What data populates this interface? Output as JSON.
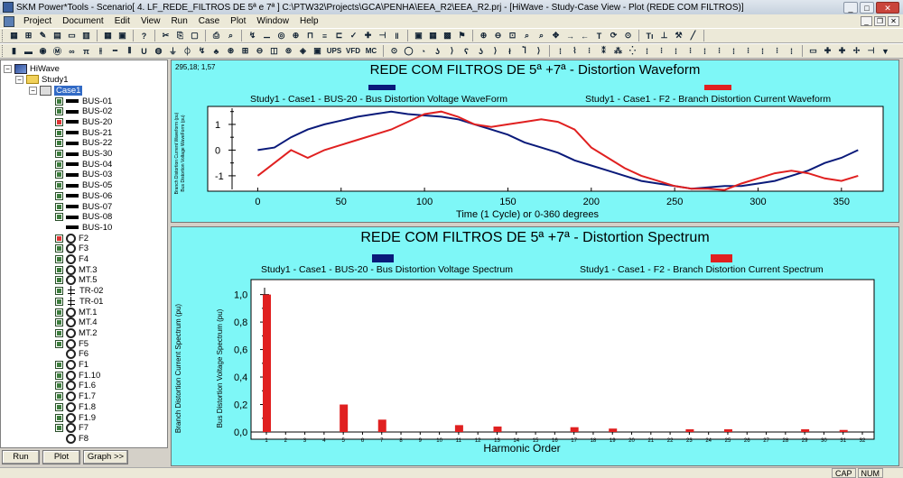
{
  "window": {
    "title": "SKM Power*Tools - Scenario[ 4. LF_REDE_FILTROS DE 5ª e 7ª ] C:\\PTW32\\Projects\\GCA\\PENHA\\EEA_R2\\EEA_R2.prj - [HiWave - Study-Case View - Plot (REDE COM FILTROS)]"
  },
  "menu": [
    "Project",
    "Document",
    "Edit",
    "View",
    "Run",
    "Case",
    "Plot",
    "Window",
    "Help"
  ],
  "toolbar1": [
    "UPS",
    "VFD",
    "MC"
  ],
  "tree": {
    "root": "HiWave",
    "study": "Study1",
    "case": "Case1",
    "items": [
      {
        "label": "BUS-01",
        "kind": "bus",
        "checked": false
      },
      {
        "label": "BUS-02",
        "kind": "bus",
        "checked": false
      },
      {
        "label": "BUS-20",
        "kind": "bus",
        "checked": true
      },
      {
        "label": "BUS-21",
        "kind": "bus",
        "checked": false
      },
      {
        "label": "BUS-22",
        "kind": "bus",
        "checked": false
      },
      {
        "label": "BUS-30",
        "kind": "bus",
        "checked": false
      },
      {
        "label": "BUS-04",
        "kind": "bus",
        "checked": false
      },
      {
        "label": "BUS-03",
        "kind": "bus",
        "checked": false
      },
      {
        "label": "BUS-05",
        "kind": "bus",
        "checked": false
      },
      {
        "label": "BUS-06",
        "kind": "bus",
        "checked": false
      },
      {
        "label": "BUS-07",
        "kind": "bus",
        "checked": false
      },
      {
        "label": "BUS-08",
        "kind": "bus",
        "checked": false
      },
      {
        "label": "BUS-10",
        "kind": "bus-nochk",
        "checked": false
      },
      {
        "label": "F2",
        "kind": "ct",
        "checked": true
      },
      {
        "label": "F3",
        "kind": "ct",
        "checked": false
      },
      {
        "label": "F4",
        "kind": "ct",
        "checked": false
      },
      {
        "label": "MT.3",
        "kind": "ct",
        "checked": false
      },
      {
        "label": "MT.5",
        "kind": "ct",
        "checked": false
      },
      {
        "label": "TR-02",
        "kind": "tr",
        "checked": false
      },
      {
        "label": "TR-01",
        "kind": "tr",
        "checked": false
      },
      {
        "label": "MT.1",
        "kind": "ct",
        "checked": false
      },
      {
        "label": "MT.4",
        "kind": "ct",
        "checked": false
      },
      {
        "label": "MT.2",
        "kind": "ct",
        "checked": false
      },
      {
        "label": "F5",
        "kind": "ct",
        "checked": false
      },
      {
        "label": "F6",
        "kind": "ct-nochk",
        "checked": false
      },
      {
        "label": "F1",
        "kind": "ct",
        "checked": false
      },
      {
        "label": "F1.10",
        "kind": "ct",
        "checked": false
      },
      {
        "label": "F1.6",
        "kind": "ct",
        "checked": false
      },
      {
        "label": "F1.7",
        "kind": "ct",
        "checked": false
      },
      {
        "label": "F1.8",
        "kind": "ct",
        "checked": false
      },
      {
        "label": "F1.9",
        "kind": "ct",
        "checked": false
      },
      {
        "label": "F7",
        "kind": "ct",
        "checked": false
      },
      {
        "label": "F8",
        "kind": "ct-nochk",
        "checked": false
      }
    ]
  },
  "left_buttons": {
    "run": "Run",
    "plot": "Plot",
    "graph": "Graph >>"
  },
  "status": {
    "cap": "CAP",
    "num": "NUM"
  },
  "coord_readout": "295,18; 1,57",
  "colors": {
    "background": "#7ef7f7",
    "voltage": "#0a1a7a",
    "current": "#e02020"
  },
  "chart_data": [
    {
      "type": "line",
      "title": "REDE COM FILTROS DE 5ª +7ª - Distortion Waveform",
      "xlabel": "Time (1 Cycle) or 0-360 degrees",
      "ylabel_left": "Branch Distortion Current Waveform (pu)",
      "ylabel_right": "Bus Distortion Voltage WaveForm (pu)",
      "xlim": [
        -30,
        375
      ],
      "ylim": [
        -1.6,
        1.7
      ],
      "xticks": [
        "0",
        "50",
        "100",
        "150",
        "200",
        "250",
        "300",
        "350"
      ],
      "yticks": [
        "-1",
        "0",
        "1"
      ],
      "series": [
        {
          "name": "Study1 - Case1 - BUS-20 - Bus Distortion Voltage WaveForm",
          "color": "#0a1a7a",
          "x": [
            0,
            10,
            20,
            30,
            40,
            50,
            60,
            70,
            80,
            90,
            100,
            110,
            120,
            130,
            140,
            150,
            160,
            170,
            180,
            190,
            200,
            210,
            220,
            230,
            240,
            250,
            260,
            270,
            280,
            290,
            300,
            310,
            320,
            330,
            340,
            350,
            360
          ],
          "y": [
            0.0,
            0.1,
            0.5,
            0.8,
            1.0,
            1.15,
            1.3,
            1.4,
            1.5,
            1.4,
            1.35,
            1.3,
            1.2,
            1.0,
            0.8,
            0.6,
            0.3,
            0.1,
            -0.1,
            -0.4,
            -0.6,
            -0.8,
            -1.0,
            -1.2,
            -1.3,
            -1.4,
            -1.5,
            -1.45,
            -1.4,
            -1.4,
            -1.3,
            -1.2,
            -1.0,
            -0.8,
            -0.5,
            -0.3,
            0.0
          ]
        },
        {
          "name": "Study1 - Case1 - F2 - Branch Distortion Current Waveform",
          "color": "#e02020",
          "x": [
            0,
            10,
            20,
            30,
            40,
            50,
            60,
            70,
            80,
            90,
            100,
            110,
            120,
            130,
            140,
            150,
            160,
            170,
            180,
            190,
            200,
            210,
            220,
            230,
            240,
            250,
            260,
            270,
            280,
            290,
            300,
            310,
            320,
            330,
            340,
            350,
            360
          ],
          "y": [
            -1.0,
            -0.5,
            0.0,
            -0.3,
            0.0,
            0.2,
            0.4,
            0.6,
            0.8,
            1.1,
            1.4,
            1.5,
            1.3,
            1.0,
            0.9,
            1.0,
            1.1,
            1.2,
            1.1,
            0.8,
            0.1,
            -0.3,
            -0.7,
            -1.0,
            -1.2,
            -1.4,
            -1.5,
            -1.5,
            -1.55,
            -1.3,
            -1.1,
            -0.9,
            -0.8,
            -0.9,
            -1.1,
            -1.2,
            -1.0
          ]
        }
      ]
    },
    {
      "type": "bar",
      "title": "REDE COM FILTROS DE 5ª +7ª - Distortion Spectrum",
      "xlabel": "Harmonic Order",
      "ylabel_left": "Branch Distortion Current Spectrum (pu)",
      "ylabel_right": "Bus Distortion Voltage Spectrum (pu)",
      "ylim": [
        0,
        1.05
      ],
      "yticks": [
        "0,0",
        "0,2",
        "0,4",
        "0,6",
        "0,8",
        "1,0"
      ],
      "categories": [
        "1",
        "2",
        "3",
        "4",
        "5",
        "6",
        "7",
        "8",
        "9",
        "10",
        "11",
        "12",
        "13",
        "14",
        "15",
        "16",
        "17",
        "18",
        "19",
        "20",
        "21",
        "22",
        "23",
        "24",
        "25",
        "26",
        "27",
        "28",
        "29",
        "30",
        "31",
        "32"
      ],
      "series": [
        {
          "name": "Study1 - Case1 - BUS-20 - Bus Distortion Voltage Spectrum",
          "color": "#0a1a7a",
          "values": [
            0,
            0,
            0,
            0,
            0,
            0,
            0,
            0,
            0,
            0,
            0,
            0,
            0,
            0,
            0,
            0,
            0,
            0,
            0,
            0,
            0,
            0,
            0,
            0,
            0,
            0,
            0,
            0,
            0,
            0,
            0,
            0
          ]
        },
        {
          "name": "Study1 - Case1 - F2 - Branch Distortion Current Spectrum",
          "color": "#e02020",
          "values": [
            1.0,
            0,
            0,
            0,
            0.2,
            0,
            0.09,
            0,
            0,
            0,
            0.05,
            0,
            0.04,
            0,
            0,
            0,
            0.035,
            0,
            0.025,
            0,
            0,
            0,
            0.02,
            0,
            0.02,
            0,
            0,
            0,
            0.02,
            0,
            0.015,
            0
          ]
        }
      ]
    }
  ]
}
